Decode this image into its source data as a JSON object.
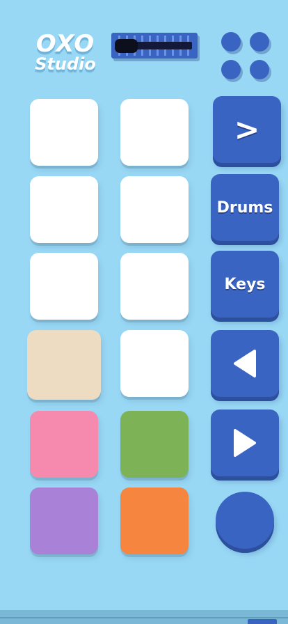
{
  "app": {
    "logo_line1": "OXO",
    "logo_line2": "Studio"
  },
  "controls": {
    "next_label": ">",
    "drums_label": "Drums",
    "keys_label": "Keys",
    "back_icon": "triangle-left-icon",
    "play_icon": "play-icon",
    "record_icon": "circle-icon"
  },
  "pads": [
    {
      "id": "pad-1",
      "color": "#ffffff"
    },
    {
      "id": "pad-2",
      "color": "#ffffff"
    },
    {
      "id": "pad-3",
      "color": "#ffffff"
    },
    {
      "id": "pad-4",
      "color": "#ffffff"
    },
    {
      "id": "pad-5",
      "color": "#ffffff"
    },
    {
      "id": "pad-6",
      "color": "#ffffff"
    },
    {
      "id": "pad-7",
      "color": "#eedcc2"
    },
    {
      "id": "pad-8",
      "color": "#ffffff"
    },
    {
      "id": "pad-9",
      "color": "#f68aae"
    },
    {
      "id": "pad-10",
      "color": "#7db356"
    },
    {
      "id": "pad-11",
      "color": "#a981d6"
    },
    {
      "id": "pad-12",
      "color": "#f5853f"
    }
  ],
  "theme": {
    "background": "#99d8f5",
    "button_blue": "#3a64c2"
  }
}
